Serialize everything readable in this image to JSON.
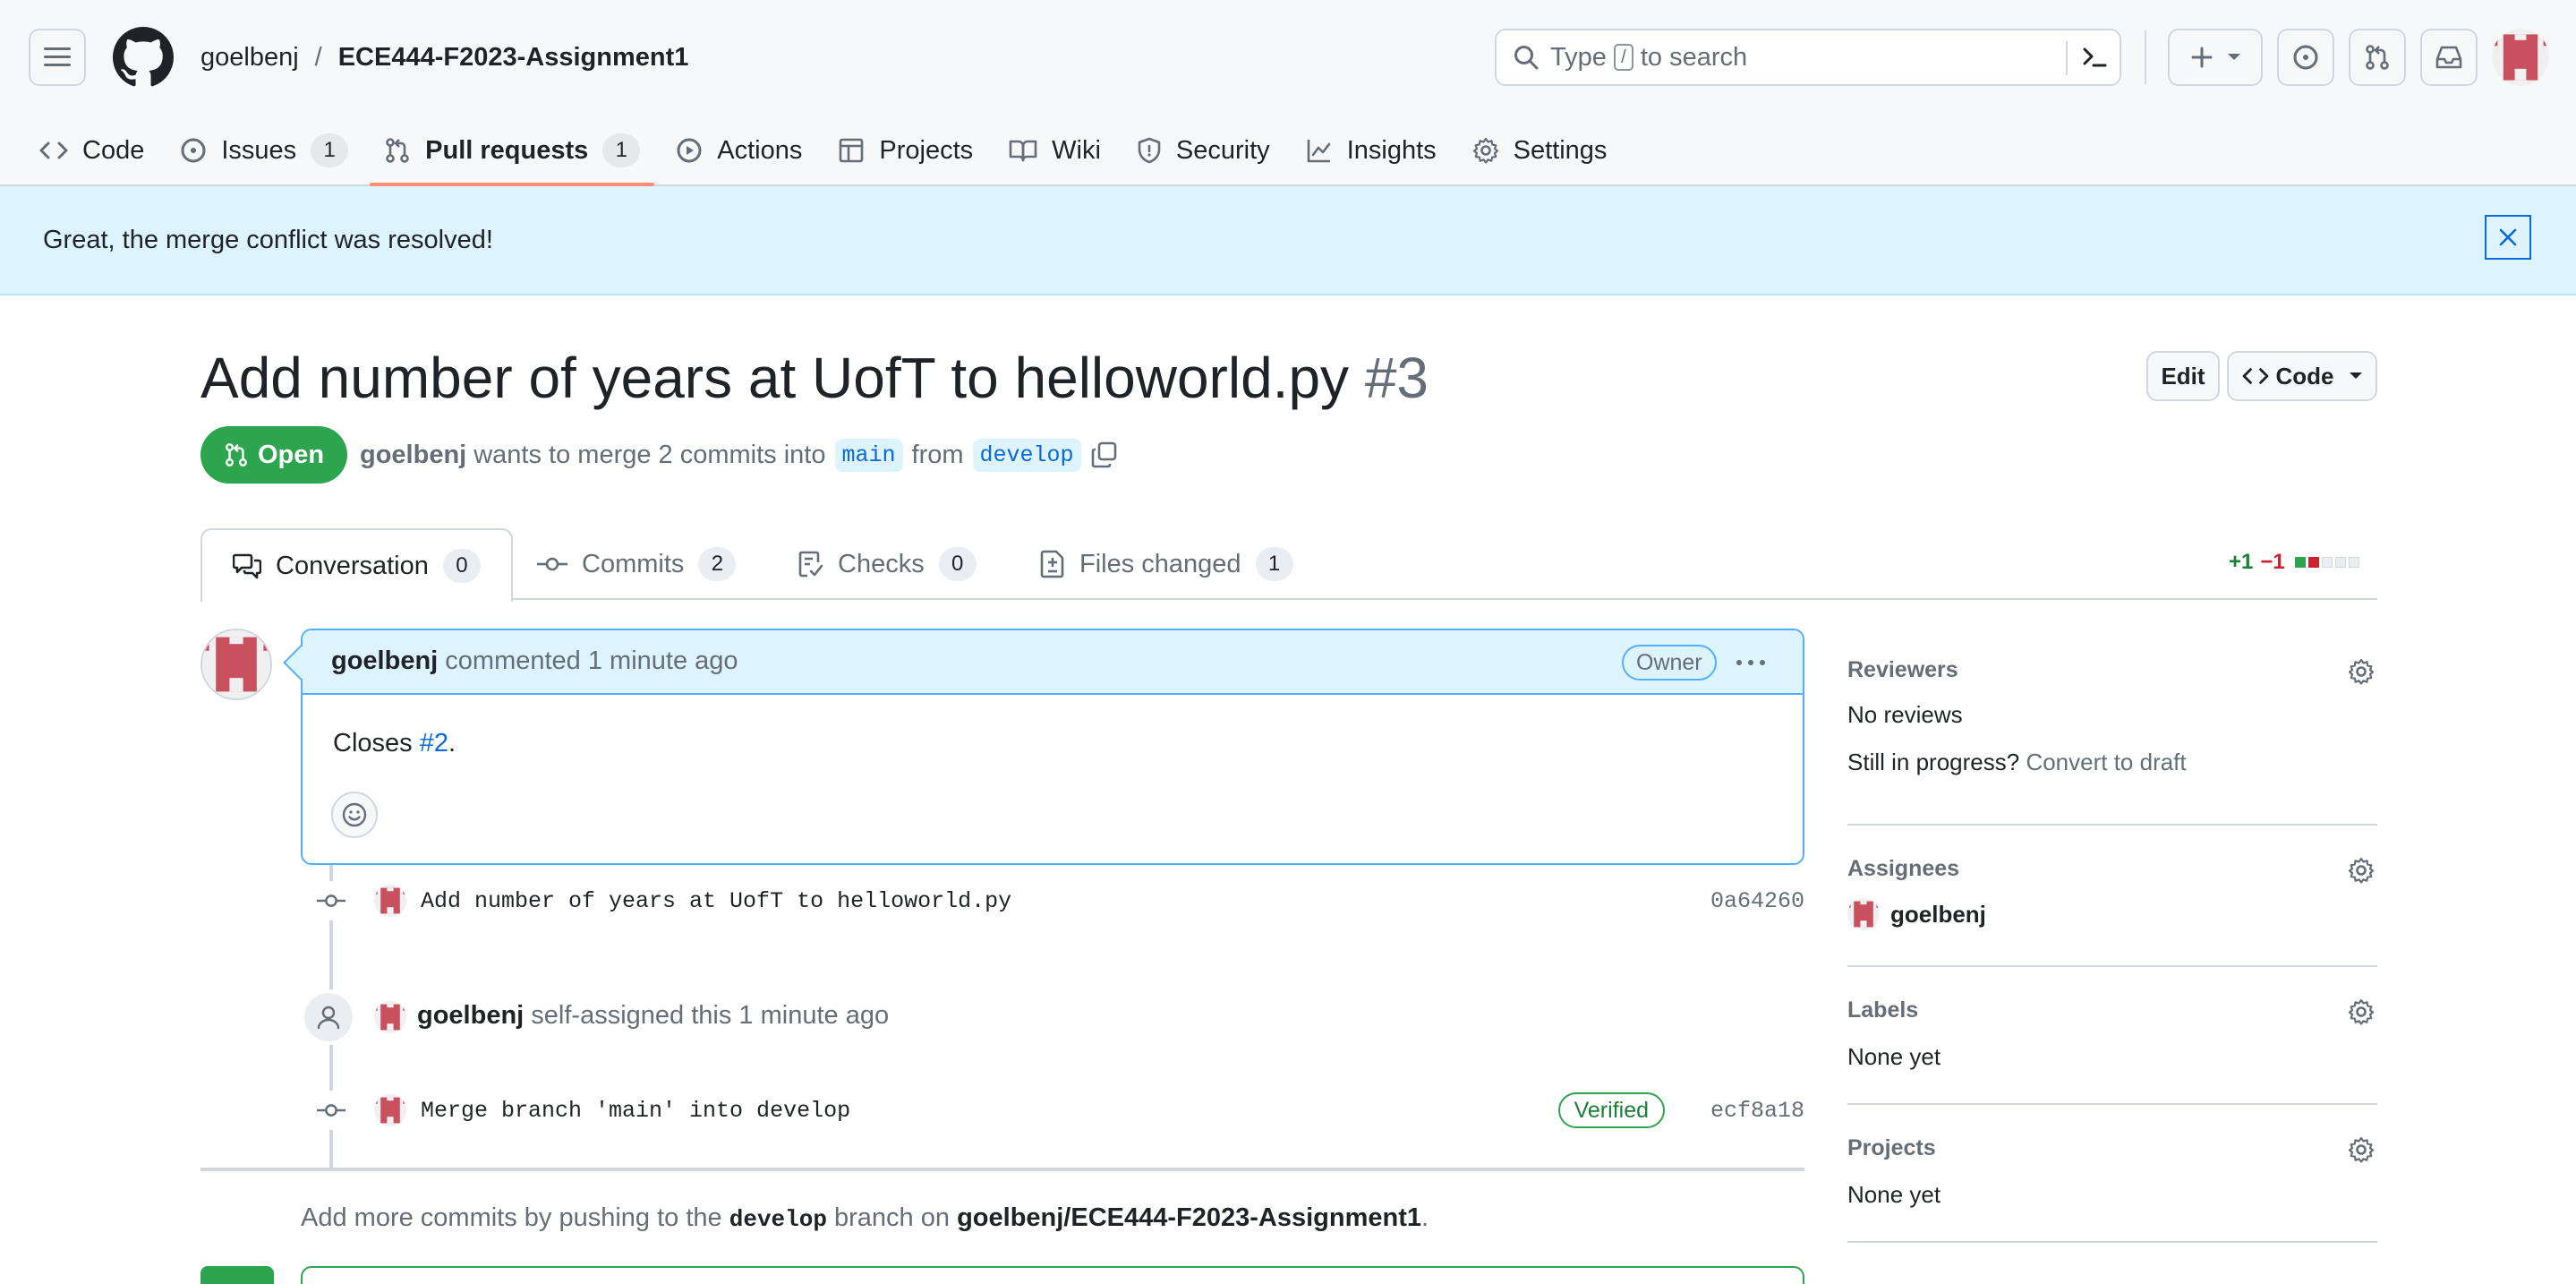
{
  "header": {
    "repo_owner": "goelbenj",
    "repo_separator": "/",
    "repo_name": "ECE444-F2023-Assignment1",
    "search_placeholder_before": "Type",
    "search_placeholder_key": "/",
    "search_placeholder_after": "to search"
  },
  "repo_nav": {
    "code": "Code",
    "issues": "Issues",
    "issues_count": "1",
    "pulls": "Pull requests",
    "pulls_count": "1",
    "actions": "Actions",
    "projects": "Projects",
    "wiki": "Wiki",
    "security": "Security",
    "insights": "Insights",
    "settings": "Settings"
  },
  "flash": {
    "message": "Great, the merge conflict was resolved!"
  },
  "pr": {
    "title": "Add number of years at UofT to helloworld.py",
    "number": "#3",
    "edit_label": "Edit",
    "code_label": "Code",
    "state": "Open",
    "author": "goelbenj",
    "meta_mid": "wants to merge 2 commits into",
    "base_branch": "main",
    "meta_from": "from",
    "head_branch": "develop"
  },
  "tabs": {
    "conversation": "Conversation",
    "conversation_count": "0",
    "commits": "Commits",
    "commits_count": "2",
    "checks": "Checks",
    "checks_count": "0",
    "files": "Files changed",
    "files_count": "1",
    "additions": "+1",
    "deletions": "−1",
    "diff_blocks": [
      "added",
      "removed",
      "neutral",
      "neutral",
      "neutral"
    ],
    "colors": {
      "added": "#2da44e",
      "removed": "#cf222e",
      "neutral": "#eaeef2"
    }
  },
  "comment": {
    "author": "goelbenj",
    "action": "commented",
    "time": "1 minute ago",
    "badge": "Owner",
    "body_prefix": "Closes",
    "body_link": "#2",
    "body_suffix": "."
  },
  "timeline": {
    "commit1_msg": "Add number of years at UofT to helloworld.py",
    "commit1_sha": "0a64260",
    "assign_user": "goelbenj",
    "assign_text": "self-assigned this",
    "assign_time": "1 minute ago",
    "commit2_msg": "Merge branch 'main' into develop",
    "commit2_verified": "Verified",
    "commit2_sha": "ecf8a18",
    "push_hint_prefix": "Add more commits by pushing to the",
    "push_hint_branch": "develop",
    "push_hint_mid": "branch on",
    "push_hint_repo": "goelbenj/ECE444-F2023-Assignment1",
    "push_hint_suffix": "."
  },
  "sidebar": {
    "reviewers_title": "Reviewers",
    "reviewers_value": "No reviews",
    "reviewers_progress": "Still in progress?",
    "reviewers_draft_link": "Convert to draft",
    "assignees_title": "Assignees",
    "assignee_name": "goelbenj",
    "labels_title": "Labels",
    "labels_value": "None yet",
    "projects_title": "Projects",
    "projects_value": "None yet"
  },
  "colors": {
    "accent_blue": "#0969da",
    "open_green": "#2da44e",
    "flash_bg": "#ddf4ff",
    "tab_underline": "#fd8c73",
    "avatar": "#c9515f"
  }
}
